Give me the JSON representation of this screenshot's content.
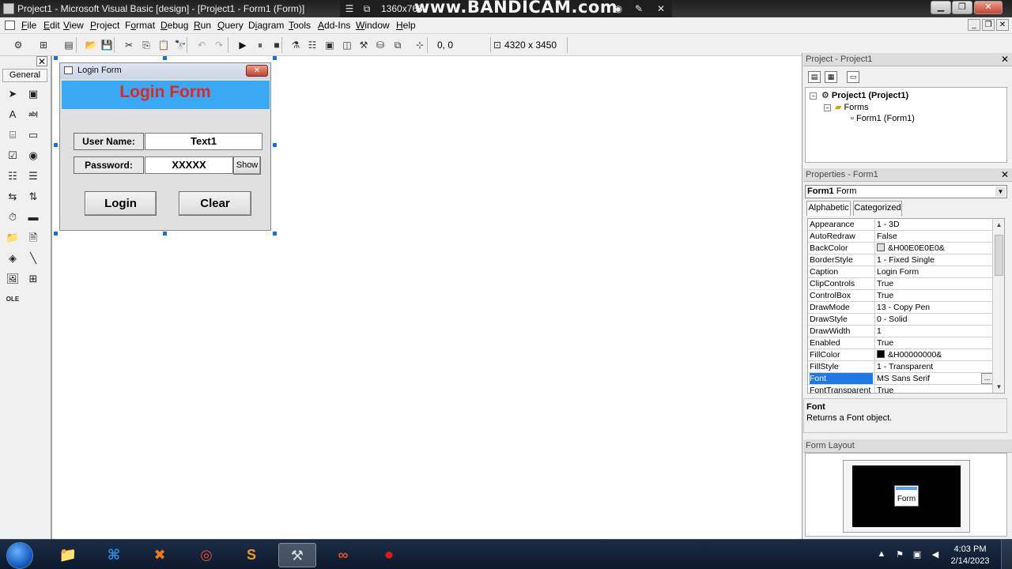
{
  "window": {
    "title": "Project1 - Microsoft Visual Basic [design] - [Project1 - Form1 (Form)]",
    "resolution": "1360x768",
    "watermark": "www.BANDICAM.com",
    "minimize_glyph": "▁",
    "restore_glyph": "❐",
    "close_glyph": "✕",
    "record_glyphs": [
      "☰",
      "⧉",
      "◉",
      "✎",
      "✕"
    ]
  },
  "menu": {
    "items": [
      {
        "acc": "F",
        "rest": "ile"
      },
      {
        "acc": "E",
        "rest": "dit"
      },
      {
        "acc": "V",
        "rest": "iew"
      },
      {
        "acc": "P",
        "rest": "roject"
      },
      {
        "acc": "",
        "rest": "Format",
        "acc_index": 1
      },
      {
        "acc": "D",
        "rest": "ebug"
      },
      {
        "acc": "R",
        "rest": "un"
      },
      {
        "acc": "Q",
        "rest": "uery"
      },
      {
        "acc": "",
        "rest": "Diagram",
        "acc_index": 1
      },
      {
        "acc": "T",
        "rest": "ools"
      },
      {
        "acc": "A",
        "rest": "dd-Ins"
      },
      {
        "acc": "W",
        "rest": "indow"
      },
      {
        "acc": "H",
        "rest": "elp"
      }
    ],
    "mdi_glyphs": [
      "_",
      "❐",
      "✕"
    ]
  },
  "toolbar": {
    "position": "0, 0",
    "size": "4320 x 3450",
    "icons": [
      "add-project-icon",
      "add-form-icon",
      "menu-editor-icon",
      "open-icon",
      "save-icon",
      "cut-icon",
      "copy-icon",
      "paste-icon",
      "find-icon",
      "undo-icon",
      "redo-icon",
      "run-icon",
      "pause-icon",
      "stop-icon",
      "project-explorer-icon",
      "properties-icon",
      "form-layout-icon",
      "object-browser-icon",
      "toolbox-icon",
      "data-view-icon",
      "visual-component-manager-icon"
    ]
  },
  "toolbox": {
    "tab_label": "General",
    "close_glyph": "✕",
    "tools": [
      {
        "name": "pointer-tool-icon",
        "glyph": "➤"
      },
      {
        "name": "picturebox-tool-icon",
        "glyph": "▣"
      },
      {
        "name": "label-tool-icon",
        "glyph": "A"
      },
      {
        "name": "textbox-tool-icon",
        "glyph": "ab|"
      },
      {
        "name": "frame-tool-icon",
        "glyph": "⌸"
      },
      {
        "name": "commandbutton-tool-icon",
        "glyph": "▭"
      },
      {
        "name": "checkbox-tool-icon",
        "glyph": "☑"
      },
      {
        "name": "optionbutton-tool-icon",
        "glyph": "◉"
      },
      {
        "name": "combobox-tool-icon",
        "glyph": "☷"
      },
      {
        "name": "listbox-tool-icon",
        "glyph": "☰"
      },
      {
        "name": "hscrollbar-tool-icon",
        "glyph": "⇆"
      },
      {
        "name": "vscrollbar-tool-icon",
        "glyph": "⇅"
      },
      {
        "name": "timer-tool-icon",
        "glyph": "⏱"
      },
      {
        "name": "drivelistbox-tool-icon",
        "glyph": "▬"
      },
      {
        "name": "dirlistbox-tool-icon",
        "glyph": "📁"
      },
      {
        "name": "filelistbox-tool-icon",
        "glyph": "🗎"
      },
      {
        "name": "shape-tool-icon",
        "glyph": "◈"
      },
      {
        "name": "line-tool-icon",
        "glyph": "╲"
      },
      {
        "name": "image-tool-icon",
        "glyph": "🖼"
      },
      {
        "name": "data-tool-icon",
        "glyph": "⊞"
      },
      {
        "name": "ole-tool-icon",
        "glyph": "OLE"
      }
    ]
  },
  "form": {
    "caption": "Login Form",
    "close_glyph": "✕",
    "heading": "Login Form",
    "username_label": "User Name:",
    "username_value": "Text1",
    "password_label": "Password:",
    "password_value": "XXXXX",
    "show_button": "Show",
    "login_button": "Login",
    "clear_button": "Clear",
    "banner_color": "#39a9f6",
    "heading_color": "#e8241e"
  },
  "project_panel": {
    "title": "Project - Project1",
    "close_glyph": "✕",
    "tree": {
      "project": "Project1 (Project1)",
      "folder": "Forms",
      "form": "Form1 (Form1)",
      "collapse_glyph": "−"
    }
  },
  "properties_panel": {
    "title": "Properties - Form1",
    "close_glyph": "✕",
    "object_name": "Form1",
    "object_type": "Form",
    "tabs": [
      "Alphabetic",
      "Categorized"
    ],
    "rows": [
      {
        "name": "Appearance",
        "value": "1 - 3D"
      },
      {
        "name": "AutoRedraw",
        "value": "False"
      },
      {
        "name": "BackColor",
        "value": "&H00E0E0E0&",
        "swatch": "#e0e0e0"
      },
      {
        "name": "BorderStyle",
        "value": "1 - Fixed Single"
      },
      {
        "name": "Caption",
        "value": "Login Form"
      },
      {
        "name": "ClipControls",
        "value": "True"
      },
      {
        "name": "ControlBox",
        "value": "True"
      },
      {
        "name": "DrawMode",
        "value": "13 - Copy Pen"
      },
      {
        "name": "DrawStyle",
        "value": "0 - Solid"
      },
      {
        "name": "DrawWidth",
        "value": "1"
      },
      {
        "name": "Enabled",
        "value": "True"
      },
      {
        "name": "FillColor",
        "value": "&H00000000&",
        "swatch": "#000000"
      },
      {
        "name": "FillStyle",
        "value": "1 - Transparent"
      },
      {
        "name": "Font",
        "value": "MS Sans Serif",
        "selected": true
      },
      {
        "name": "FontTransparent",
        "value": "True"
      }
    ],
    "desc_title": "Font",
    "desc_text": "Returns a Font object."
  },
  "layout_panel": {
    "title": "Form Layout",
    "form_label": "Form"
  },
  "taskbar": {
    "apps": [
      {
        "name": "explorer-taskbar-icon",
        "glyph": "📁"
      },
      {
        "name": "vscode-taskbar-icon",
        "glyph": "⌘"
      },
      {
        "name": "xampp-taskbar-icon",
        "glyph": "✖"
      },
      {
        "name": "chrome-taskbar-icon",
        "glyph": "◎"
      },
      {
        "name": "sublime-taskbar-icon",
        "glyph": "S"
      },
      {
        "name": "vb6-taskbar-icon",
        "glyph": "⚒",
        "active": true
      },
      {
        "name": "infinity-taskbar-icon",
        "glyph": "∞"
      },
      {
        "name": "bandicam-taskbar-icon",
        "glyph": "⏺"
      }
    ],
    "time": "4:03 PM",
    "date": "2/14/2023"
  }
}
